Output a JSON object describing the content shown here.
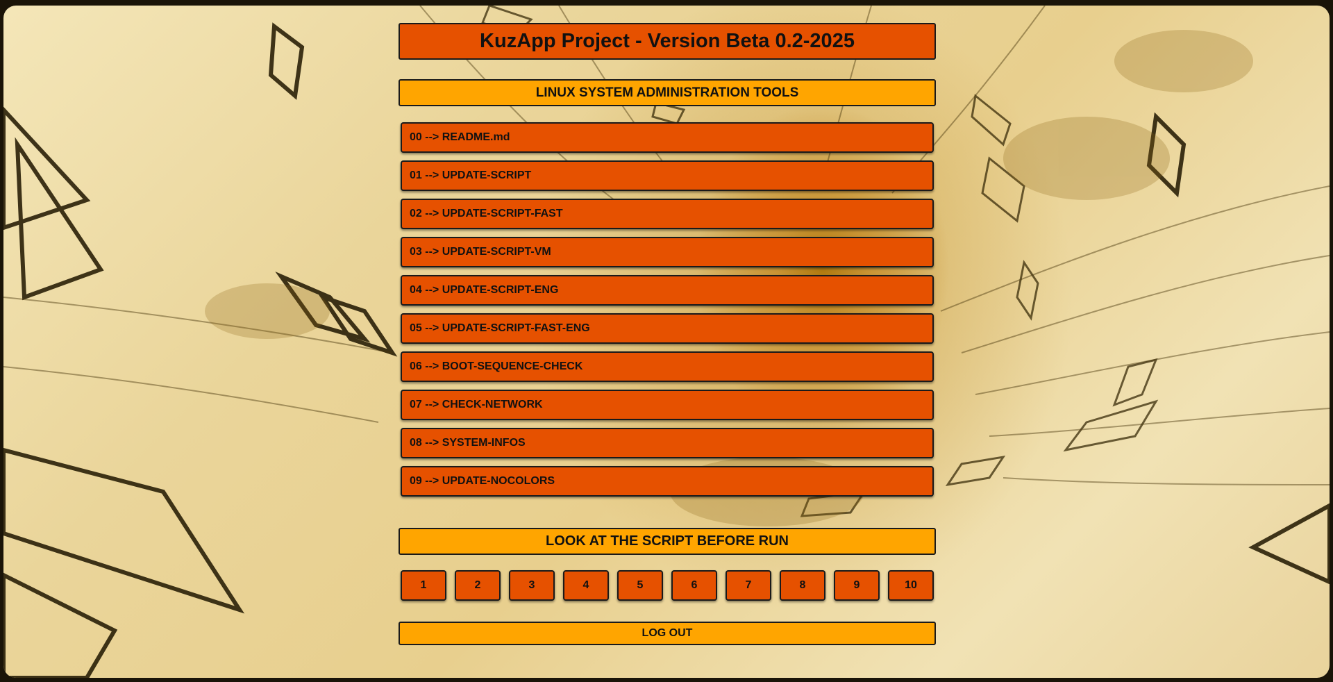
{
  "header": {
    "title": "KuzApp Project - Version Beta 0.2-2025"
  },
  "sections": {
    "tools_title": "LINUX SYSTEM ADMINISTRATION TOOLS",
    "look_title": "LOOK AT THE SCRIPT BEFORE RUN"
  },
  "menu": {
    "items": [
      {
        "label": "00 --> README.md"
      },
      {
        "label": "01 --> UPDATE-SCRIPT"
      },
      {
        "label": "02 --> UPDATE-SCRIPT-FAST"
      },
      {
        "label": "03 --> UPDATE-SCRIPT-VM"
      },
      {
        "label": "04 --> UPDATE-SCRIPT-ENG"
      },
      {
        "label": "05 --> UPDATE-SCRIPT-FAST-ENG"
      },
      {
        "label": "06 --> BOOT-SEQUENCE-CHECK"
      },
      {
        "label": "07 --> CHECK-NETWORK"
      },
      {
        "label": "08 --> SYSTEM-INFOS"
      },
      {
        "label": "09 --> UPDATE-NOCOLORS"
      }
    ]
  },
  "script_buttons": [
    "1",
    "2",
    "3",
    "4",
    "5",
    "6",
    "7",
    "8",
    "9",
    "10"
  ],
  "logout_label": "LOG OUT",
  "colors": {
    "button_orange": "#e65100",
    "header_amber": "#ffa500",
    "border": "#1a1a1a",
    "background_light": "#f0e0b0",
    "background_dark": "#b07a10"
  }
}
